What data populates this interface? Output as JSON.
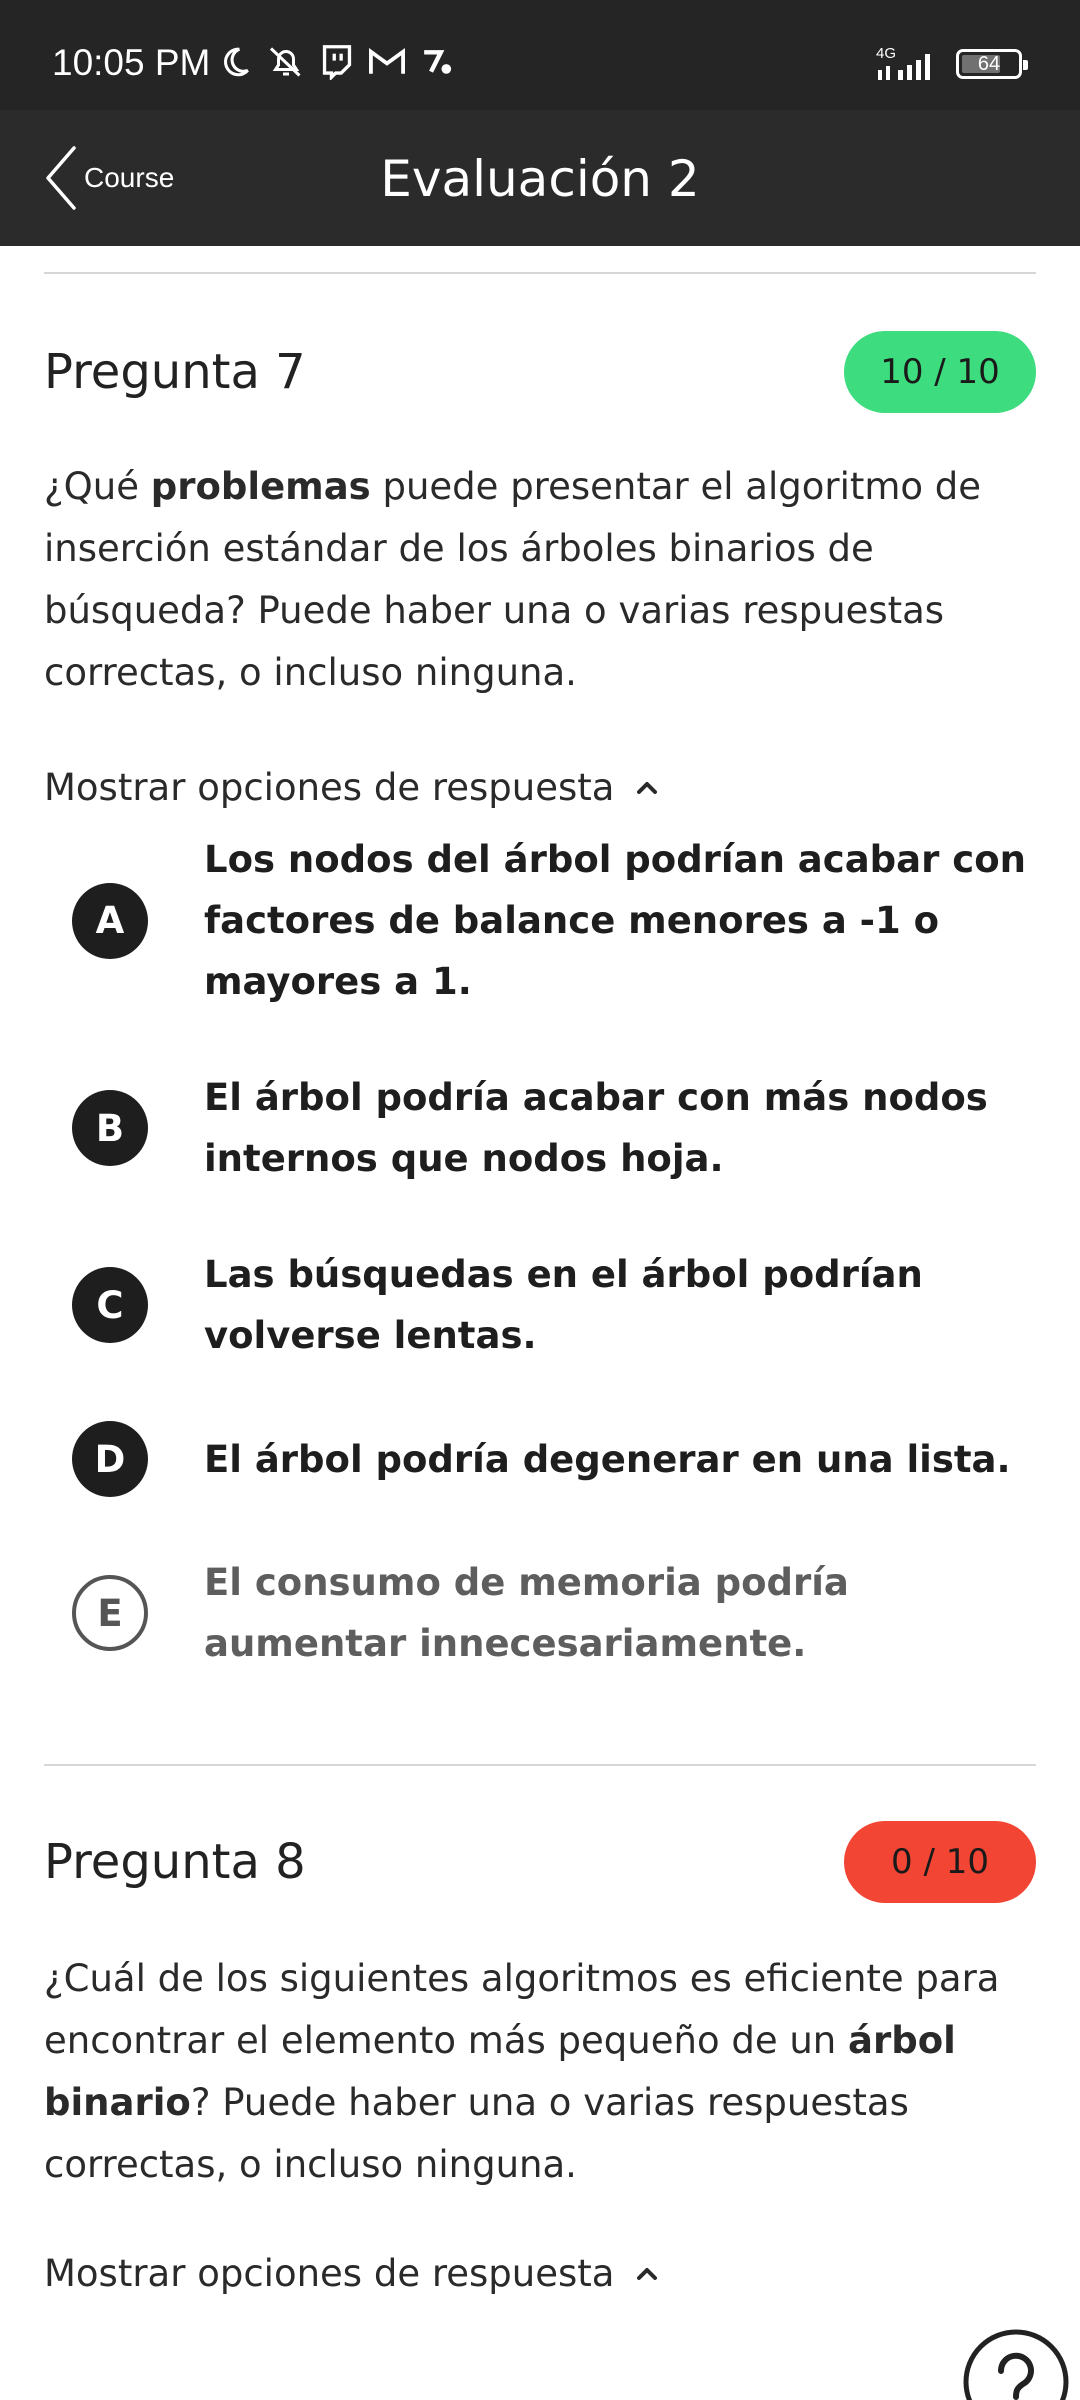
{
  "status_bar": {
    "time": "10:05 PM",
    "network": "4G",
    "battery": "64"
  },
  "app_bar": {
    "back_label": "Course",
    "title": "Evaluación 2"
  },
  "questions": [
    {
      "title": "Pregunta 7",
      "score": "10 / 10",
      "score_color": "#3ddc7e",
      "text_parts": [
        "¿Qué ",
        "problemas",
        " puede presentar el algoritmo de inserción estándar de los árboles binarios de búsqueda? Puede haber una o varias respuestas correctas, o incluso ninguna."
      ],
      "toggle_label": "Mostrar opciones de respuesta",
      "options": [
        {
          "letter": "A",
          "text": "Los nodos del árbol podrían acabar con factores de balance menores a -1 o mayores a 1.",
          "selected": true
        },
        {
          "letter": "B",
          "text": "El árbol podría acabar con más nodos internos que nodos hoja.",
          "selected": true
        },
        {
          "letter": "C",
          "text": "Las búsquedas en el árbol podrían volverse lentas.",
          "selected": true
        },
        {
          "letter": "D",
          "text": "El árbol podría degenerar en una lista.",
          "selected": true
        },
        {
          "letter": "E",
          "text": "El consumo de memoria podría aumentar innecesariamente.",
          "selected": false
        }
      ]
    },
    {
      "title": "Pregunta 8",
      "score": "0 / 10",
      "score_color": "#f24534",
      "text_parts": [
        "¿Cuál de los siguientes algoritmos es eficiente para encontrar el elemento más pequeño de un ",
        "árbol binario",
        "? Puede haber una o varias respuestas correctas, o incluso ninguna."
      ],
      "toggle_label": "Mostrar opciones de respuesta"
    }
  ],
  "icons": {
    "back": "chevron-left-icon",
    "toggle": "chevron-up-icon",
    "help": "help-circle-icon"
  }
}
